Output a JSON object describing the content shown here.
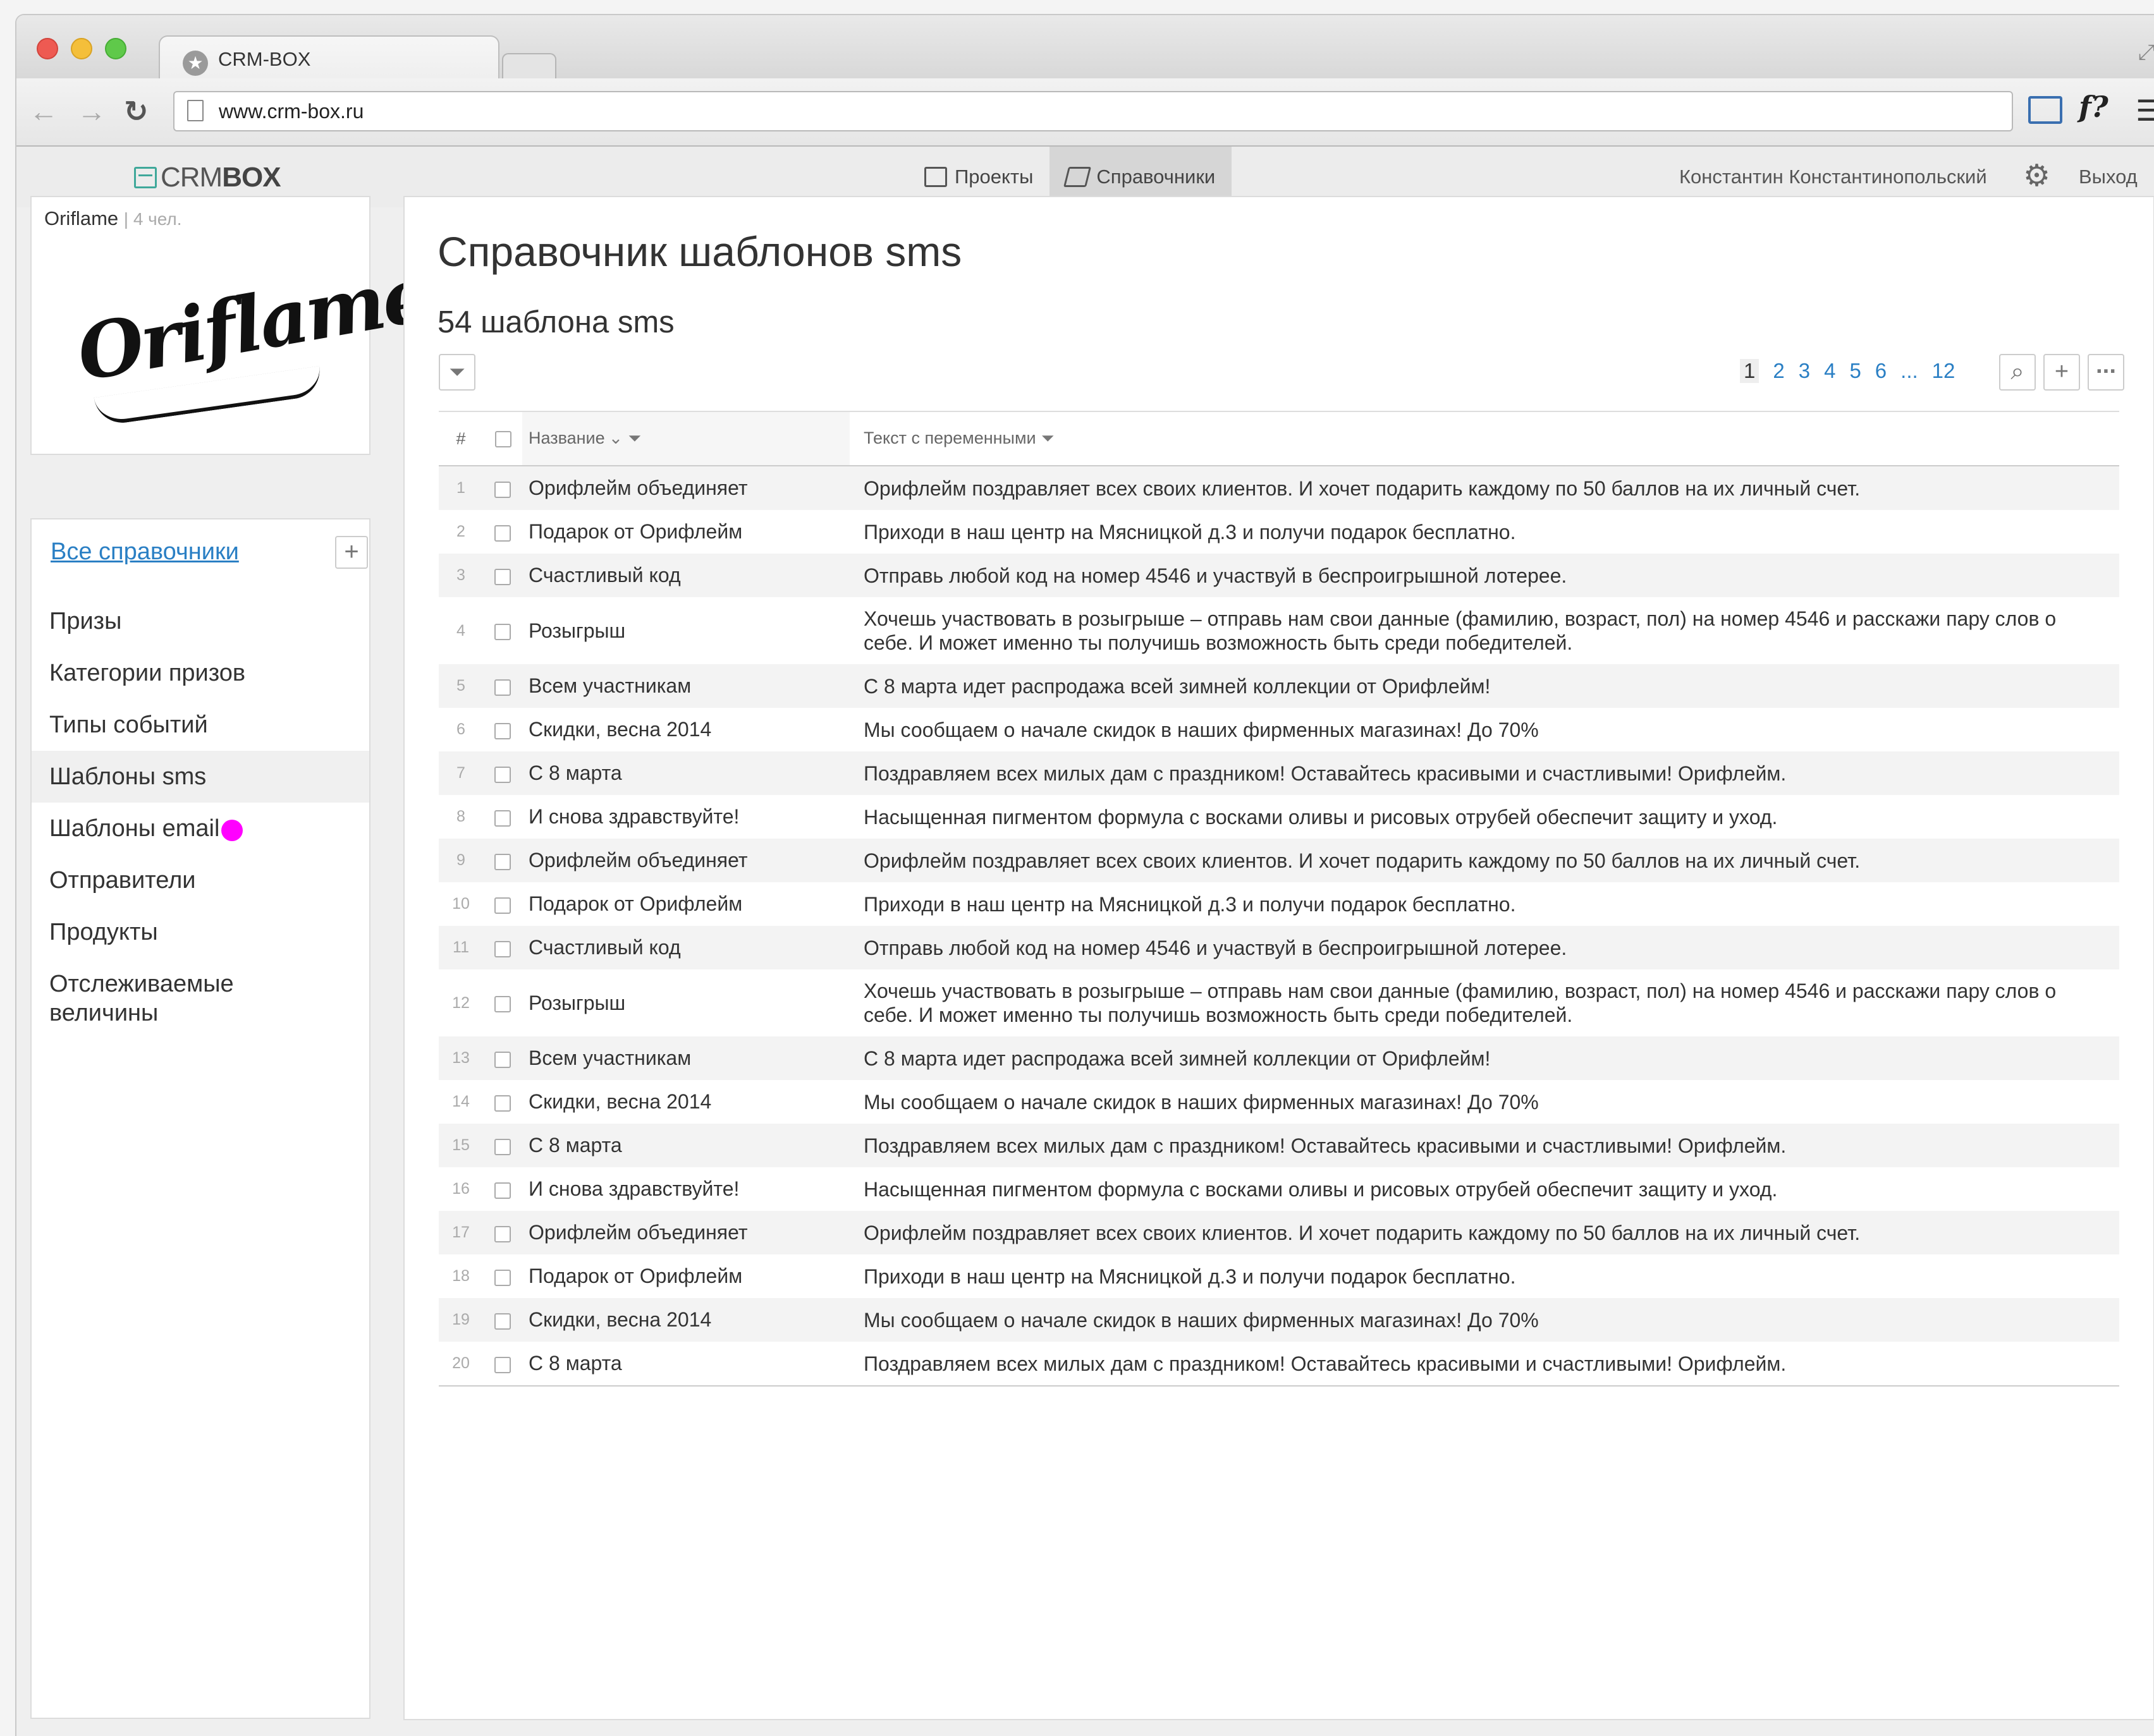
{
  "browser": {
    "tab_title": "CRM-BOX",
    "url": "www.crm-box.ru",
    "extension_label": "f?"
  },
  "app": {
    "logo_crm": "CRM",
    "logo_box": "BOX",
    "nav": [
      {
        "label": "Проекты",
        "icon": "archive-icon"
      },
      {
        "label": "Справочники",
        "icon": "book-icon",
        "active": true
      }
    ],
    "user_name": "Константин Константинопольский",
    "logout": "Выход"
  },
  "org": {
    "name": "Oriflame",
    "members": "| 4 чел.",
    "logo_text": "Oriflame"
  },
  "sidebar": {
    "all_link": "Все справочники",
    "add_label": "+",
    "items": [
      {
        "label": "Призы"
      },
      {
        "label": "Категории призов"
      },
      {
        "label": "Типы событий"
      },
      {
        "label": "Шаблоны sms",
        "active": true
      },
      {
        "label": "Шаблоны email"
      },
      {
        "label": "Отправители"
      },
      {
        "label": "Продукты"
      },
      {
        "label": "Отслеживаемые величины"
      }
    ]
  },
  "main": {
    "title": "Справочник шаблонов sms",
    "count": "54 шаблона sms",
    "pagination": {
      "current": "1",
      "pages": [
        "2",
        "3",
        "4",
        "5",
        "6",
        "...",
        "12"
      ]
    },
    "table": {
      "columns": {
        "index": "#",
        "name": "Название",
        "text": "Текст с переменными"
      },
      "rows": [
        {
          "n": "1",
          "name": "Орифлейм объединяет",
          "text": "Орифлейм поздравляет всех своих клиентов. И хочет подарить каждому по 50 баллов на их личный счет."
        },
        {
          "n": "2",
          "name": "Подарок от Орифлейм",
          "text": "Приходи в наш центр на Мясницкой д.3 и получи подарок бесплатно."
        },
        {
          "n": "3",
          "name": "Счастливый код",
          "text": "Отправь любой код на номер 4546 и участвуй в беспроигрышной лотерее."
        },
        {
          "n": "4",
          "name": "Розыгрыш",
          "text": "Хочешь участвовать в розыгрыше – отправь нам свои данные (фамилию, возраст, пол) на номер 4546 и расскажи пару слов о себе. И может именно ты получишь возможность быть среди победителей."
        },
        {
          "n": "5",
          "name": "Всем участникам",
          "text": "С 8 марта идет распродажа всей зимней коллекции от Орифлейм!"
        },
        {
          "n": "6",
          "name": "Скидки, весна 2014",
          "text": "Мы сообщаем о начале скидок в наших фирменных магазинах! До 70%"
        },
        {
          "n": "7",
          "name": "С 8 марта",
          "text": "Поздравляем всех милых дам с праздником! Оставайтесь красивыми и счастливыми! Орифлейм."
        },
        {
          "n": "8",
          "name": "И снова здравствуйте!",
          "text": "Насыщенная пигментом формула с восками оливы и рисовых отрубей обеспечит защиту и уход."
        },
        {
          "n": "9",
          "name": "Орифлейм объединяет",
          "text": "Орифлейм поздравляет всех своих клиентов. И хочет подарить каждому по 50 баллов на их личный счет."
        },
        {
          "n": "10",
          "name": "Подарок от Орифлейм",
          "text": "Приходи в наш центр на Мясницкой д.3 и получи подарок бесплатно."
        },
        {
          "n": "11",
          "name": "Счастливый код",
          "text": "Отправь любой код на номер 4546 и участвуй в беспроигрышной лотерее."
        },
        {
          "n": "12",
          "name": "Розыгрыш",
          "text": "Хочешь участвовать в розыгрыше – отправь нам свои данные (фамилию, возраст, пол) на номер 4546 и расскажи пару слов о себе. И может именно ты получишь возможность быть среди победителей."
        },
        {
          "n": "13",
          "name": "Всем участникам",
          "text": "С 8 марта идет распродажа всей зимней коллекции от Орифлейм!"
        },
        {
          "n": "14",
          "name": "Скидки, весна 2014",
          "text": "Мы сообщаем о начале скидок в наших фирменных магазинах! До 70%"
        },
        {
          "n": "15",
          "name": "С 8 марта",
          "text": "Поздравляем всех милых дам с праздником! Оставайтесь красивыми и счастливыми! Орифлейм."
        },
        {
          "n": "16",
          "name": "И снова здравствуйте!",
          "text": "Насыщенная пигментом формула с восками оливы и рисовых отрубей обеспечит защиту и уход."
        },
        {
          "n": "17",
          "name": "Орифлейм объединяет",
          "text": "Орифлейм поздравляет всех своих клиентов. И хочет подарить каждому по 50 баллов на их личный счет."
        },
        {
          "n": "18",
          "name": "Подарок от Орифлейм",
          "text": "Приходи в наш центр на Мясницкой д.3 и получи подарок бесплатно."
        },
        {
          "n": "19",
          "name": "Скидки, весна 2014",
          "text": "Мы сообщаем о начале скидок в наших фирменных магазинах! До 70%"
        },
        {
          "n": "20",
          "name": "С 8 марта",
          "text": "Поздравляем всех милых дам с праздником! Оставайтесь красивыми и счастливыми! Орифлейм."
        }
      ]
    }
  },
  "colors": {
    "link": "#2a7fc4",
    "accent": "#3fa89a",
    "cursor": "#ff00ff"
  }
}
